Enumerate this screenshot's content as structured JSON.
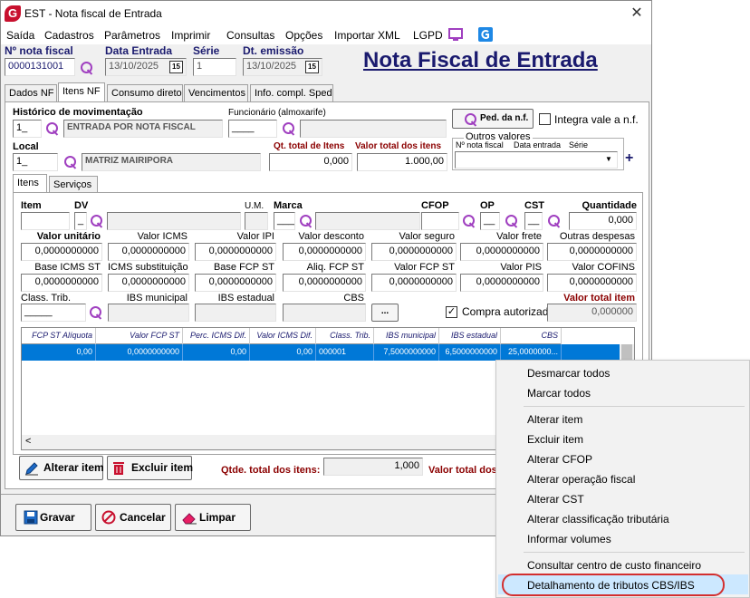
{
  "window": {
    "title": "EST - Nota fiscal de Entrada",
    "app_logo": "G",
    "close_glyph": "✕"
  },
  "menu": [
    "Saída",
    "Cadastros",
    "Parâmetros",
    "Imprimir",
    "Consultas",
    "Opções",
    "Importar XML",
    "LGPD"
  ],
  "header": {
    "nota_fiscal_label": "Nº nota fiscal",
    "nota_fiscal_value": "0000131001",
    "data_entrada_label": "Data Entrada",
    "data_entrada_value": "13/10/2025",
    "serie_label": "Série",
    "serie_value": "1",
    "dt_emissao_label": "Dt. emissão",
    "dt_emissao_value": "13/10/2025",
    "calendar_glyph": "15",
    "page_title": "Nota Fiscal de Entrada"
  },
  "tabs": [
    "Dados NF",
    "Itens NF",
    "Consumo direto",
    "Vencimentos",
    "Info. compl. Sped"
  ],
  "itens_nf": {
    "historico_label": "Histórico de movimentação",
    "historico_code": "1_",
    "historico_desc": "ENTRADA POR NOTA FISCAL",
    "funcionario_label": "Funcionário (almoxarife)",
    "funcionario_code": "____",
    "ped_btn": "Ped. da n.f.",
    "integra_label": "Integra vale a n.f.",
    "local_label": "Local",
    "local_code": "1_",
    "local_desc": "MATRIZ MAIRIPORA",
    "qt_total_label": "Qt. total de Itens",
    "qt_total_value": "0,000",
    "valor_total_label": "Valor total dos itens",
    "valor_total_value": "1.000,00",
    "outros_label": "Outros valores",
    "outros_nota": "Nº nota fiscal",
    "outros_data": "Data entrada",
    "outros_serie": "Série",
    "plus": "+",
    "dropdown_arrow": "▼"
  },
  "subtabs": [
    "Itens",
    "Serviços"
  ],
  "item_form": {
    "item_label": "Item",
    "dv_label": "DV",
    "dv_value": "_",
    "um_label": "U.M.",
    "marca_label": "Marca",
    "marca_value": "____",
    "cfop_label": "CFOP",
    "op_label": "OP",
    "op_value": "__",
    "cst_label": "CST",
    "cst_value": "__",
    "quantidade_label": "Quantidade",
    "quantidade_value": "0,000",
    "row1_labels": [
      "Valor unitário",
      "Valor ICMS",
      "Valor IPI",
      "Valor desconto",
      "Valor seguro",
      "Valor frete",
      "Outras despesas"
    ],
    "row1_values": [
      "0,0000000000",
      "0,0000000000",
      "0,0000000000",
      "0,0000000000",
      "0,0000000000",
      "0,0000000000",
      "0,0000000000"
    ],
    "row2_labels": [
      "Base ICMS ST",
      "ICMS substituição",
      "Base FCP ST",
      "Aliq. FCP ST",
      "Valor FCP ST",
      "Valor PIS",
      "Valor COFINS"
    ],
    "row2_values": [
      "0,0000000000",
      "0,0000000000",
      "0,0000000000",
      "0,0000000000",
      "0,0000000000",
      "0,0000000000",
      "0,0000000000"
    ],
    "class_trib_label": "Class. Trib.",
    "class_trib_value": "_____",
    "ibs_mun_label": "IBS municipal",
    "ibs_est_label": "IBS estadual",
    "cbs_label": "CBS",
    "ellipsis": "...",
    "compra_label": "Compra autorizada",
    "compra_check": "✓",
    "valor_total_item_label": "Valor total item",
    "valor_total_item_value": "0,000000"
  },
  "grid": {
    "headers": [
      "FCP ST Alíquota",
      "Valor FCP ST",
      "Perc. ICMS Dif.",
      "Valor ICMS Dif.",
      "Class. Trib.",
      "IBS municipal",
      "IBS estadual",
      "CBS"
    ],
    "row": [
      "0,00",
      "0,0000000000",
      "0,00",
      "0,00",
      "000001",
      "7,5000000000",
      "6,5000000000",
      "25,0000000..."
    ],
    "scroll_left": "<"
  },
  "bottom": {
    "alterar_btn": "Alterar item",
    "excluir_btn": "Excluir item",
    "qtde_total_label": "Qtde. total dos itens:",
    "qtde_total_value": "1,000",
    "valor_total_label": "Valor total dos"
  },
  "footer": {
    "gravar_btn": "Gravar",
    "cancelar_btn": "Cancelar",
    "limpar_btn": "Limpar"
  },
  "context_menu": {
    "group1": [
      "Desmarcar todos",
      "Marcar todos"
    ],
    "group2": [
      "Alterar item",
      "Excluir item",
      "Alterar CFOP",
      "Alterar operação fiscal",
      "Alterar CST",
      "Alterar classificação tributária",
      "Informar volumes"
    ],
    "group3": [
      "Consultar centro de custo financeiro",
      "Detalhamento de tributos CBS/IBS"
    ]
  },
  "colors": {
    "accent_navy": "#1a1a6e",
    "highlight_blue": "#0078d7",
    "label_red": "#8b0000",
    "search_purple": "#a040c0",
    "ring_red": "#d32f2f"
  }
}
